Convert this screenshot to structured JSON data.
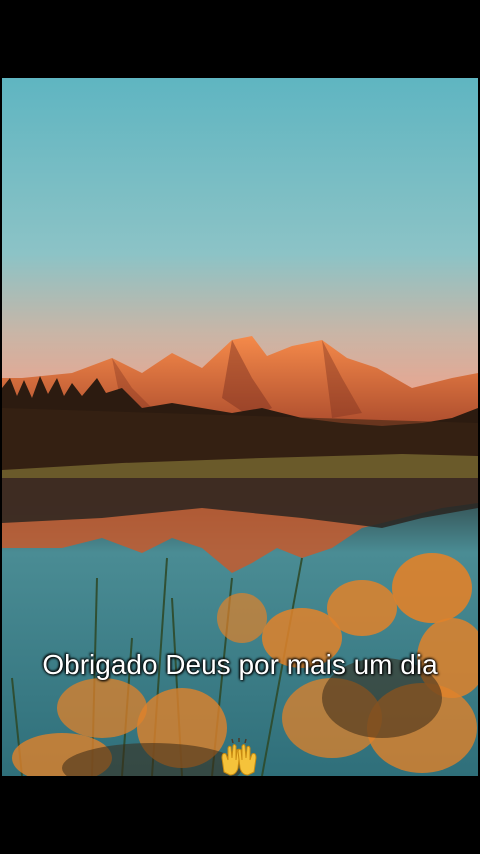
{
  "caption": {
    "text": "Obrigado Deus por mais um dia",
    "emoji": "raising-hands-emoji"
  },
  "scene": {
    "sky_top": "#62b6c2",
    "sky_mid": "#8cc2c5",
    "sky_horizon": "#e7a994",
    "mountain_light": "#f07a3c",
    "mountain_shadow": "#8a3a26",
    "forest": "#2a1a10",
    "water": "#3f8c95",
    "flowers": "#e58a2c"
  }
}
